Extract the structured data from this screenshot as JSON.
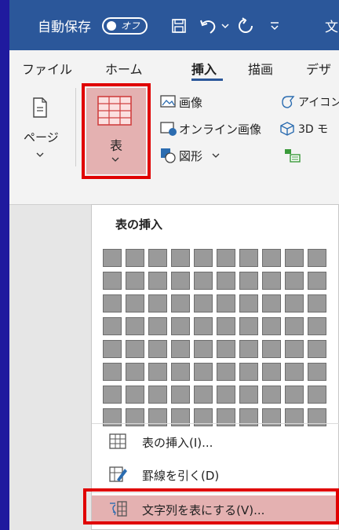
{
  "titlebar": {
    "autosave": "自動保存",
    "toggle": "オフ",
    "title_char": "文"
  },
  "tabs": [
    "ファイル",
    "ホーム",
    "挿入",
    "描画",
    "デザ"
  ],
  "ribbon": {
    "page_label": "ページ",
    "table_label": "表",
    "picture_label": "画像",
    "online_picture_label": "オンライン画像",
    "shapes_label": "図形",
    "icons_label": "アイコン",
    "model3d_label": "3D モ"
  },
  "dropdown": {
    "title": "表の挿入",
    "grid": {
      "columns": 10,
      "rows": 8
    },
    "items": [
      {
        "label": "表の挿入(I)...",
        "icon": "table-grid-icon"
      },
      {
        "label": "罫線を引く(D)",
        "icon": "draw-table-pencil-icon"
      },
      {
        "label": "文字列を表にする(V)...",
        "icon": "convert-text-to-table-icon"
      }
    ]
  },
  "colors": {
    "titlebar": "#2b579a",
    "highlight": "#e00000",
    "selected": "#e4b1b1",
    "background": "#1f1a9e"
  }
}
